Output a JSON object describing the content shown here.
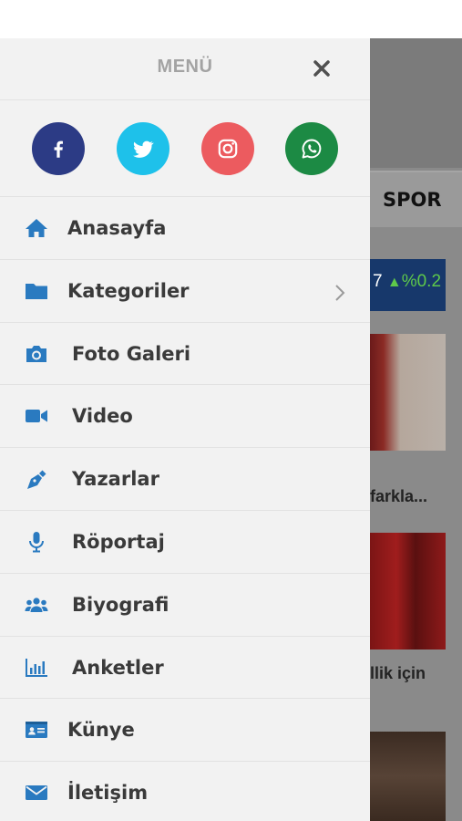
{
  "drawer": {
    "title": "MENÜ",
    "close_icon": "close-icon",
    "social": [
      {
        "name": "facebook",
        "icon": "facebook-icon",
        "color": "#2c3b85"
      },
      {
        "name": "twitter",
        "icon": "twitter-icon",
        "color": "#1ec1ea"
      },
      {
        "name": "instagram",
        "icon": "instagram-icon",
        "color": "#ec5b5f"
      },
      {
        "name": "whatsapp",
        "icon": "whatsapp-icon",
        "color": "#1c8a44"
      }
    ],
    "items": [
      {
        "label": "Anasayfa",
        "icon": "home-icon"
      },
      {
        "label": "Kategoriler",
        "icon": "folder-icon",
        "has_submenu": true
      },
      {
        "label": "Foto Galeri",
        "icon": "camera-icon"
      },
      {
        "label": "Video",
        "icon": "video-camera-icon"
      },
      {
        "label": "Yazarlar",
        "icon": "pen-nib-icon"
      },
      {
        "label": "Röportaj",
        "icon": "microphone-icon"
      },
      {
        "label": "Biyografi",
        "icon": "users-icon"
      },
      {
        "label": "Anketler",
        "icon": "bar-chart-icon"
      },
      {
        "label": "Künye",
        "icon": "id-card-icon"
      },
      {
        "label": "İletişim",
        "icon": "envelope-icon"
      }
    ],
    "icon_color": "#2a7ac0"
  },
  "background": {
    "nav_label": "SPOR",
    "ticker_value": "7",
    "ticker_change": "%0.2",
    "headline_1": "farkla...",
    "headline_2": "llik için"
  }
}
